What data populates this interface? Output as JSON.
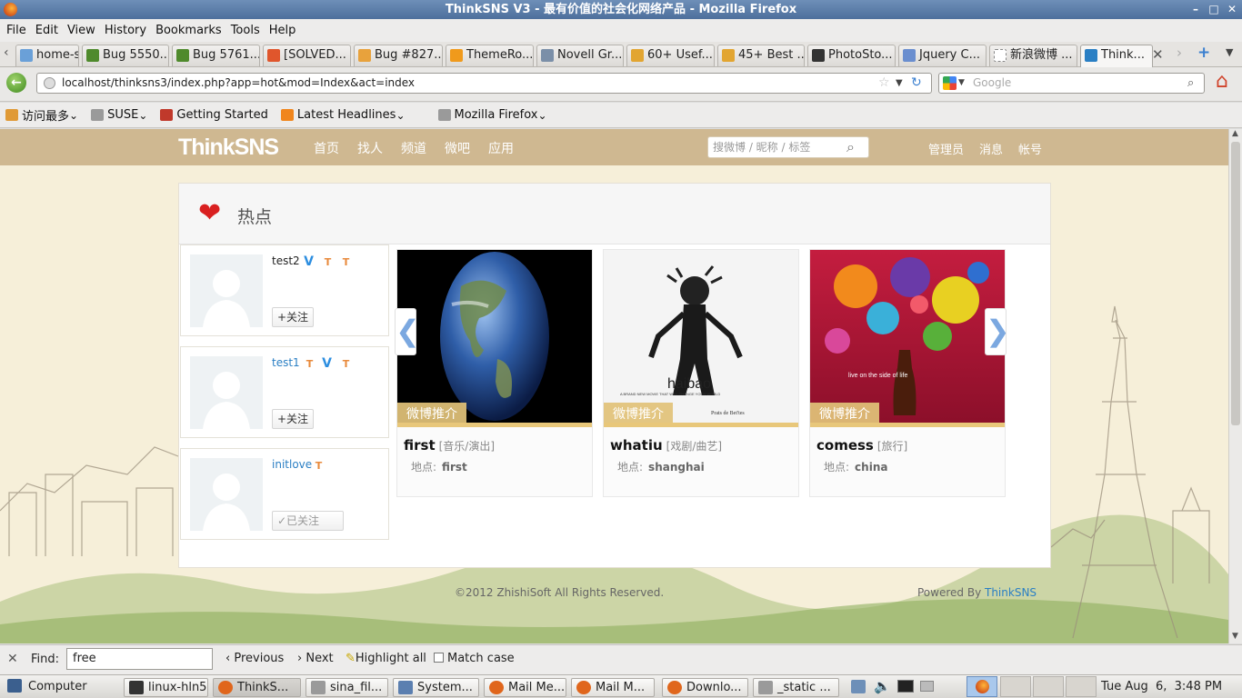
{
  "window": {
    "title": "ThinkSNS V3 - 最有价值的社会化网络产品 - Mozilla Firefox",
    "min": "–",
    "max": "□",
    "close": "✕"
  },
  "menu": [
    "File",
    "Edit",
    "View",
    "History",
    "Bookmarks",
    "Tools",
    "Help"
  ],
  "tabs": [
    {
      "label": "home-sy...",
      "color": "#6aa0d8"
    },
    {
      "label": "Bug 5550...",
      "color": "#4f8a2c"
    },
    {
      "label": "Bug 5761...",
      "color": "#4f8a2c"
    },
    {
      "label": "[SOLVED...",
      "color": "#e0562c"
    },
    {
      "label": "Bug #827...",
      "color": "#e8a23c"
    },
    {
      "label": "ThemeRo...",
      "color": "#f09a1c"
    },
    {
      "label": "Novell Gr...",
      "color": "#7b8fa8"
    },
    {
      "label": "60+ Usef...",
      "color": "#e2a531"
    },
    {
      "label": "45+ Best ...",
      "color": "#e2a531"
    },
    {
      "label": "PhotoSto...",
      "color": "#333333"
    },
    {
      "label": "Jquery C...",
      "color": "#6a8ecf"
    },
    {
      "label": "新浪微博 ...",
      "color": "#ffffff"
    },
    {
      "label": "Think...",
      "color": "#2a7fc4"
    }
  ],
  "url": "localhost/thinksns3/index.php?app=hot&mod=Index&act=index",
  "search_engine": {
    "placeholder": "Google"
  },
  "bookmarks": [
    {
      "label": "访问最多",
      "color": "#e09a36",
      "dropdown": true
    },
    {
      "label": "SUSE",
      "color": "#9a9a9a",
      "dropdown": true
    },
    {
      "label": "Getting Started",
      "color": "#c0392b",
      "dropdown": false
    },
    {
      "label": "Latest Headlines",
      "color": "#f0851c",
      "dropdown": true
    },
    {
      "label": "Mozilla Firefox",
      "color": "#9a9a9a",
      "dropdown": true
    }
  ],
  "site": {
    "logo": "ThinkSNS",
    "nav": [
      "首页",
      "找人",
      "频道",
      "微吧",
      "应用"
    ],
    "search_placeholder": "搜微博 / 昵称 / 标签",
    "right_nav": [
      "管理员",
      "消息",
      "帐号"
    ],
    "section_title": "热点",
    "users": [
      {
        "name": "test2",
        "badges": [
          "V",
          "T",
          "T"
        ],
        "button": "+关注"
      },
      {
        "name": "test1",
        "badges": [
          "T",
          "V",
          "T"
        ],
        "button": "+关注"
      },
      {
        "name": "initlove",
        "badges": [
          "T"
        ],
        "button": "✓已关注"
      }
    ],
    "items": [
      {
        "tag": "微博推介",
        "title": "first",
        "category": "[音乐/演出]",
        "loc_label": "地点:",
        "location": "first"
      },
      {
        "tag": "微博推介",
        "title": "whatiu",
        "category": "[戏剧/曲艺]",
        "loc_label": "地点:",
        "location": "shanghai"
      },
      {
        "tag": "微博推介",
        "title": "comess",
        "category": "[旅行]",
        "loc_label": "地点:",
        "location": "china"
      }
    ],
    "poster_text": {
      "haibao": "haibao",
      "line1": "A BRAND NEW MOVIE THAT WILL CHANGE YOUR WORLD",
      "brand": "Prats de Bet'tes",
      "coke": "live on the       side of life"
    },
    "prev_arrow": "❮",
    "next_arrow": "❯",
    "copyright": "©2012 ZhishiSoft All Rights Reserved.",
    "powered_label": "Powered By",
    "powered_link": "ThinkSNS"
  },
  "findbar": {
    "label": "Find:",
    "value": "free",
    "previous": "Previous",
    "next": "Next",
    "highlight": "Highlight all",
    "match_case": "Match case"
  },
  "taskbar": {
    "start": "Computer",
    "tasks": [
      {
        "label": "linux-hln5",
        "color": "#333333"
      },
      {
        "label": "ThinkS...",
        "color": "#e0661c"
      },
      {
        "label": "sina_fil...",
        "color": "#9a9a9a"
      },
      {
        "label": "System...",
        "color": "#5b7fb0"
      },
      {
        "label": "Mail Me...",
        "color": "#e0661c"
      },
      {
        "label": "Mail M...",
        "color": "#e0661c"
      },
      {
        "label": "Downlo...",
        "color": "#e0661c"
      },
      {
        "label": "_static ...",
        "color": "#9a9a9a"
      }
    ],
    "clock": "Tue Aug  6,  3:48 PM"
  }
}
